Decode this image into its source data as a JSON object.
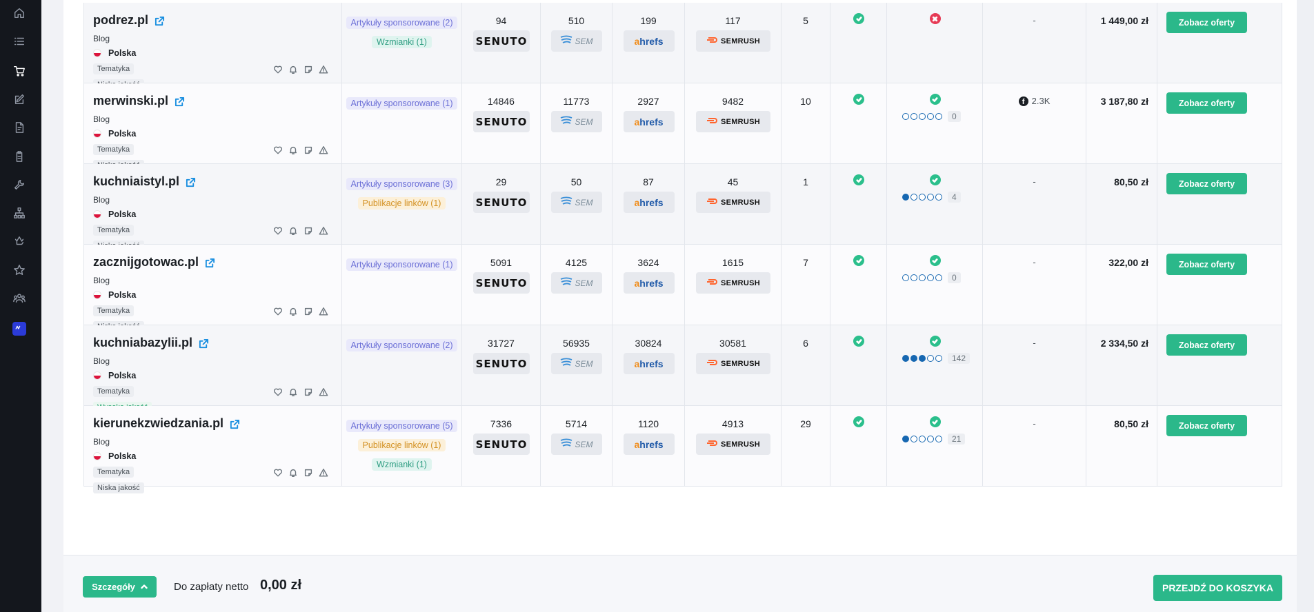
{
  "sidebar": {
    "icons": [
      "home-icon",
      "list-icon",
      "cart-icon",
      "edit-icon",
      "invoice-icon",
      "clipboard-icon",
      "tools-icon",
      "sitemap-icon",
      "recycle-icon",
      "star-icon",
      "team-icon",
      "brand-logo-icon"
    ],
    "active": "cart-icon"
  },
  "rows": [
    {
      "name": "podrez.pl",
      "type": "Blog",
      "country": "Polska",
      "topic": "Tematyka",
      "quality": "Niska jakość",
      "quality_good": false,
      "badges": [
        {
          "text": "Artykuły sponsorowane (2)",
          "kind": "spons"
        },
        {
          "text": "Wzmianki (1)",
          "kind": "wzm"
        }
      ],
      "senuto": "94",
      "sem": "510",
      "ahrefs": "199",
      "semrush": "117",
      "col5": "5",
      "indexed": true,
      "google_news": false,
      "dots": null,
      "dot_count": null,
      "social": "-",
      "social_fb": false,
      "price": "1 449,00 zł"
    },
    {
      "name": "merwinski.pl",
      "type": "Blog",
      "country": "Polska",
      "topic": "Tematyka",
      "quality": "Niska jakość",
      "quality_good": false,
      "badges": [
        {
          "text": "Artykuły sponsorowane (1)",
          "kind": "spons"
        }
      ],
      "senuto": "14846",
      "sem": "11773",
      "ahrefs": "2927",
      "semrush": "9482",
      "col5": "10",
      "indexed": true,
      "google_news": true,
      "dots": 0,
      "dot_count": "0",
      "social": "2.3K",
      "social_fb": true,
      "price": "3 187,80 zł"
    },
    {
      "name": "kuchniaistyl.pl",
      "type": "Blog",
      "country": "Polska",
      "topic": "Tematyka",
      "quality": "Niska jakość",
      "quality_good": false,
      "badges": [
        {
          "text": "Artykuły sponsorowane (3)",
          "kind": "spons"
        },
        {
          "text": "Publikacje linków (1)",
          "kind": "pub"
        }
      ],
      "senuto": "29",
      "sem": "50",
      "ahrefs": "87",
      "semrush": "45",
      "col5": "1",
      "indexed": true,
      "google_news": true,
      "dots": 1,
      "dot_count": "4",
      "social": "-",
      "social_fb": false,
      "price": "80,50 zł"
    },
    {
      "name": "zacznijgotowac.pl",
      "type": "Blog",
      "country": "Polska",
      "topic": "Tematyka",
      "quality": "Niska jakość",
      "quality_good": false,
      "badges": [
        {
          "text": "Artykuły sponsorowane (1)",
          "kind": "spons"
        }
      ],
      "senuto": "5091",
      "sem": "4125",
      "ahrefs": "3624",
      "semrush": "1615",
      "col5": "7",
      "indexed": true,
      "google_news": true,
      "dots": 0,
      "dot_count": "0",
      "social": "-",
      "social_fb": false,
      "price": "322,00 zł"
    },
    {
      "name": "kuchniabazylii.pl",
      "type": "Blog",
      "country": "Polska",
      "topic": "Tematyka",
      "quality": "Wysoka jakość",
      "quality_good": true,
      "badges": [
        {
          "text": "Artykuły sponsorowane (2)",
          "kind": "spons"
        }
      ],
      "senuto": "31727",
      "sem": "56935",
      "ahrefs": "30824",
      "semrush": "30581",
      "col5": "6",
      "indexed": true,
      "google_news": true,
      "dots": 3,
      "dot_count": "142",
      "social": "-",
      "social_fb": false,
      "price": "2 334,50 zł"
    },
    {
      "name": "kierunekzwiedzania.pl",
      "type": "Blog",
      "country": "Polska",
      "topic": "Tematyka",
      "quality": "Niska jakość",
      "quality_good": false,
      "badges": [
        {
          "text": "Artykuły sponsorowane (5)",
          "kind": "spons"
        },
        {
          "text": "Publikacje linków (1)",
          "kind": "pub"
        },
        {
          "text": "Wzmianki (1)",
          "kind": "wzm"
        }
      ],
      "senuto": "7336",
      "sem": "5714",
      "ahrefs": "1120",
      "semrush": "4913",
      "col5": "29",
      "indexed": true,
      "google_news": true,
      "dots": 1,
      "dot_count": "21",
      "social": "-",
      "social_fb": false,
      "price": "80,50 zł"
    }
  ],
  "labels": {
    "offer_button": "Zobacz oferty",
    "senuto": "SENUTO",
    "sem": "SEM",
    "ahrefs_a": "a",
    "ahrefs_rest": "hrefs",
    "semrush": "SEMRUSH"
  },
  "footer": {
    "details_button": "Szczegóły",
    "pay_label": "Do zapłaty netto",
    "pay_value": "0,00 zł",
    "cart_button": "PRZEJDŹ DO KOSZYKA"
  },
  "colors": {
    "accent": "#2bb88a",
    "sidebar_bg": "#14171d",
    "link_icon": "#1a8fe0",
    "dots": "#1667b1",
    "check": "#2bbf8c",
    "cross": "#e63a55"
  }
}
